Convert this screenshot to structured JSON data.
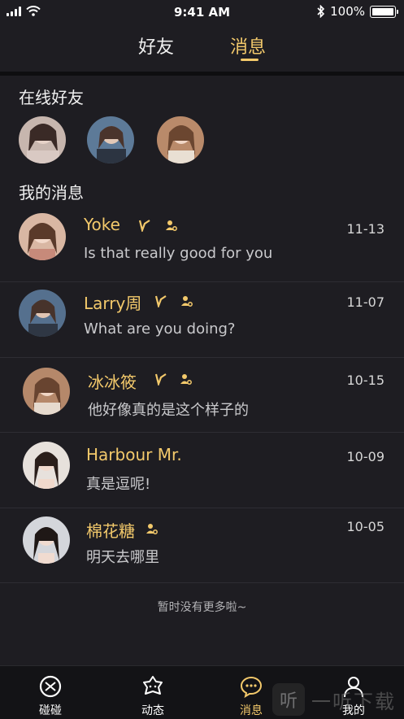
{
  "status_bar": {
    "time": "9:41 AM",
    "battery": "100%"
  },
  "top_tabs": {
    "friends": "好友",
    "messages": "消息"
  },
  "online": {
    "title": "在线好友"
  },
  "messages_section": {
    "title": "我的消息"
  },
  "messages": [
    {
      "name": "Yoke",
      "text": "Is that really good for you",
      "date": "11-13"
    },
    {
      "name": "Larry周",
      "text": "What are you doing?",
      "date": "11-07"
    },
    {
      "name": "冰冰筱",
      "text": "他好像真的是这个样子的",
      "date": "10-15"
    },
    {
      "name": "Harbour  Mr.",
      "text": "真是逗呢!",
      "date": "10-09"
    },
    {
      "name": "棉花糖",
      "text": "明天去哪里",
      "date": "10-05"
    }
  ],
  "footer_note": "暂时没有更多啦~",
  "tab_bar": {
    "items": [
      {
        "label": "碰碰",
        "icon": "bump-icon"
      },
      {
        "label": "动态",
        "icon": "feed-icon"
      },
      {
        "label": "消息",
        "icon": "chat-icon"
      },
      {
        "label": "我的",
        "icon": "profile-icon"
      }
    ],
    "active_index": 2
  },
  "watermark": {
    "text": "一听下载"
  },
  "colors": {
    "accent": "#f3c96b",
    "background": "#1e1d22",
    "text_muted": "#c9c9cc"
  }
}
